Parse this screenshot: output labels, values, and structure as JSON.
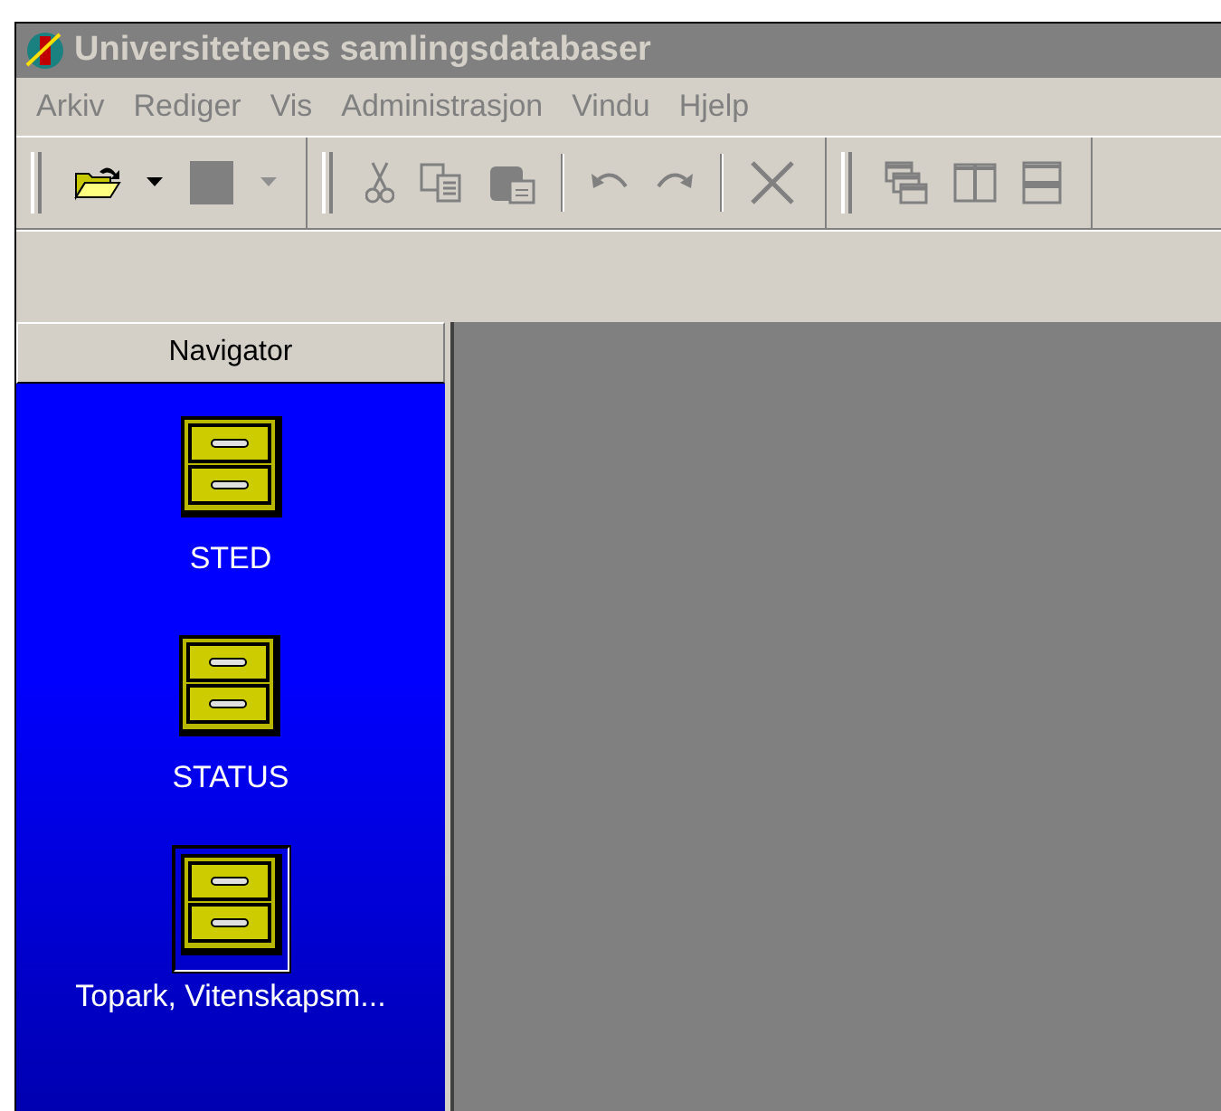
{
  "window": {
    "title": "Universitetenes samlingsdatabaser",
    "active": false
  },
  "menu": [
    {
      "label": "Arkiv",
      "disabled": true
    },
    {
      "label": "Rediger",
      "disabled": true
    },
    {
      "label": "Vis",
      "disabled": true
    },
    {
      "label": "Administrasjon",
      "disabled": true
    },
    {
      "label": "Vindu",
      "disabled": true
    },
    {
      "label": "Hjelp",
      "disabled": true
    }
  ],
  "toolbar": [
    [
      {
        "kind": "open",
        "disabled": false
      },
      {
        "kind": "dropdown",
        "disabled": false
      },
      {
        "kind": "square",
        "disabled": true
      },
      {
        "kind": "dropdown",
        "disabled": true
      }
    ],
    [
      {
        "kind": "cut",
        "disabled": true
      },
      {
        "kind": "copy",
        "disabled": true
      },
      {
        "kind": "paste",
        "disabled": true
      },
      {
        "kind": "separator"
      },
      {
        "kind": "undo",
        "disabled": true
      },
      {
        "kind": "redo",
        "disabled": true
      },
      {
        "kind": "separator"
      },
      {
        "kind": "delete",
        "disabled": true
      }
    ],
    [
      {
        "kind": "cascade",
        "disabled": true
      },
      {
        "kind": "tile-vertical",
        "disabled": true
      },
      {
        "kind": "tile-horizontal",
        "disabled": true
      }
    ]
  ],
  "navigator": {
    "title": "Navigator",
    "items": [
      {
        "label": "STED",
        "selected": false
      },
      {
        "label": "STATUS",
        "selected": false
      },
      {
        "label": "Topark, Vitenskapsm...",
        "selected": true
      }
    ]
  }
}
